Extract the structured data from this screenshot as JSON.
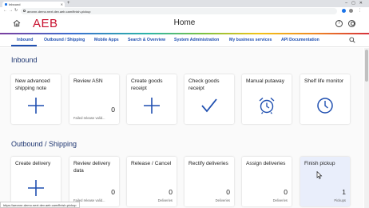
{
  "browser": {
    "tab_title": "Inbound",
    "url": "aeonnr-demo.next.dev.aeb.cam/finish-pickup",
    "status_url": "https://aeonnr-demo.next.dev.aeb.cam/finish-pickup"
  },
  "header": {
    "logo": "AEB",
    "title": "Home",
    "help_label": "?"
  },
  "nav": {
    "items": [
      {
        "label": "Inbound"
      },
      {
        "label": "Outbound / Shipping"
      },
      {
        "label": "Mobile Apps"
      },
      {
        "label": "Search & Overview"
      },
      {
        "label": "System Administration"
      },
      {
        "label": "My business services"
      },
      {
        "label": "API Documentation"
      }
    ]
  },
  "sections": {
    "inbound": {
      "title": "Inbound",
      "tiles": [
        {
          "title": "New advanced shipping note",
          "icon": "plus-icon",
          "count": "",
          "footer": ""
        },
        {
          "title": "Review ASN",
          "icon": "",
          "count": "0",
          "footer": "Failed release valid..."
        },
        {
          "title": "Create goods receipt",
          "icon": "plus-icon",
          "count": "",
          "footer": ""
        },
        {
          "title": "Check goods receipt",
          "icon": "checkmark-icon",
          "count": "",
          "footer": ""
        },
        {
          "title": "Manual putaway",
          "icon": "alarm-clock-icon",
          "count": "",
          "footer": ""
        },
        {
          "title": "Shelf life monitor",
          "icon": "clock-icon",
          "count": "",
          "footer": ""
        }
      ]
    },
    "outbound": {
      "title": "Outbound / Shipping",
      "tiles": [
        {
          "title": "Create delivery",
          "icon": "plus-icon",
          "count": "",
          "footer": ""
        },
        {
          "title": "Review delivery data",
          "icon": "",
          "count": "0",
          "footer": "Failed release valid..."
        },
        {
          "title": "Release / Cancel",
          "icon": "",
          "count": "0",
          "footer": "Deliveries"
        },
        {
          "title": "Rectify deliveries",
          "icon": "",
          "count": "0",
          "footer": "Deliveries"
        },
        {
          "title": "Assign deliveries",
          "icon": "",
          "count": "0",
          "footer": "Deliveries"
        },
        {
          "title": "Finish pickup",
          "icon": "",
          "count": "1",
          "footer": "Pickups"
        }
      ]
    }
  },
  "colors": {
    "accent": "#1f4fb0",
    "brand_red": "#c8102e",
    "heading": "#1d3570"
  }
}
